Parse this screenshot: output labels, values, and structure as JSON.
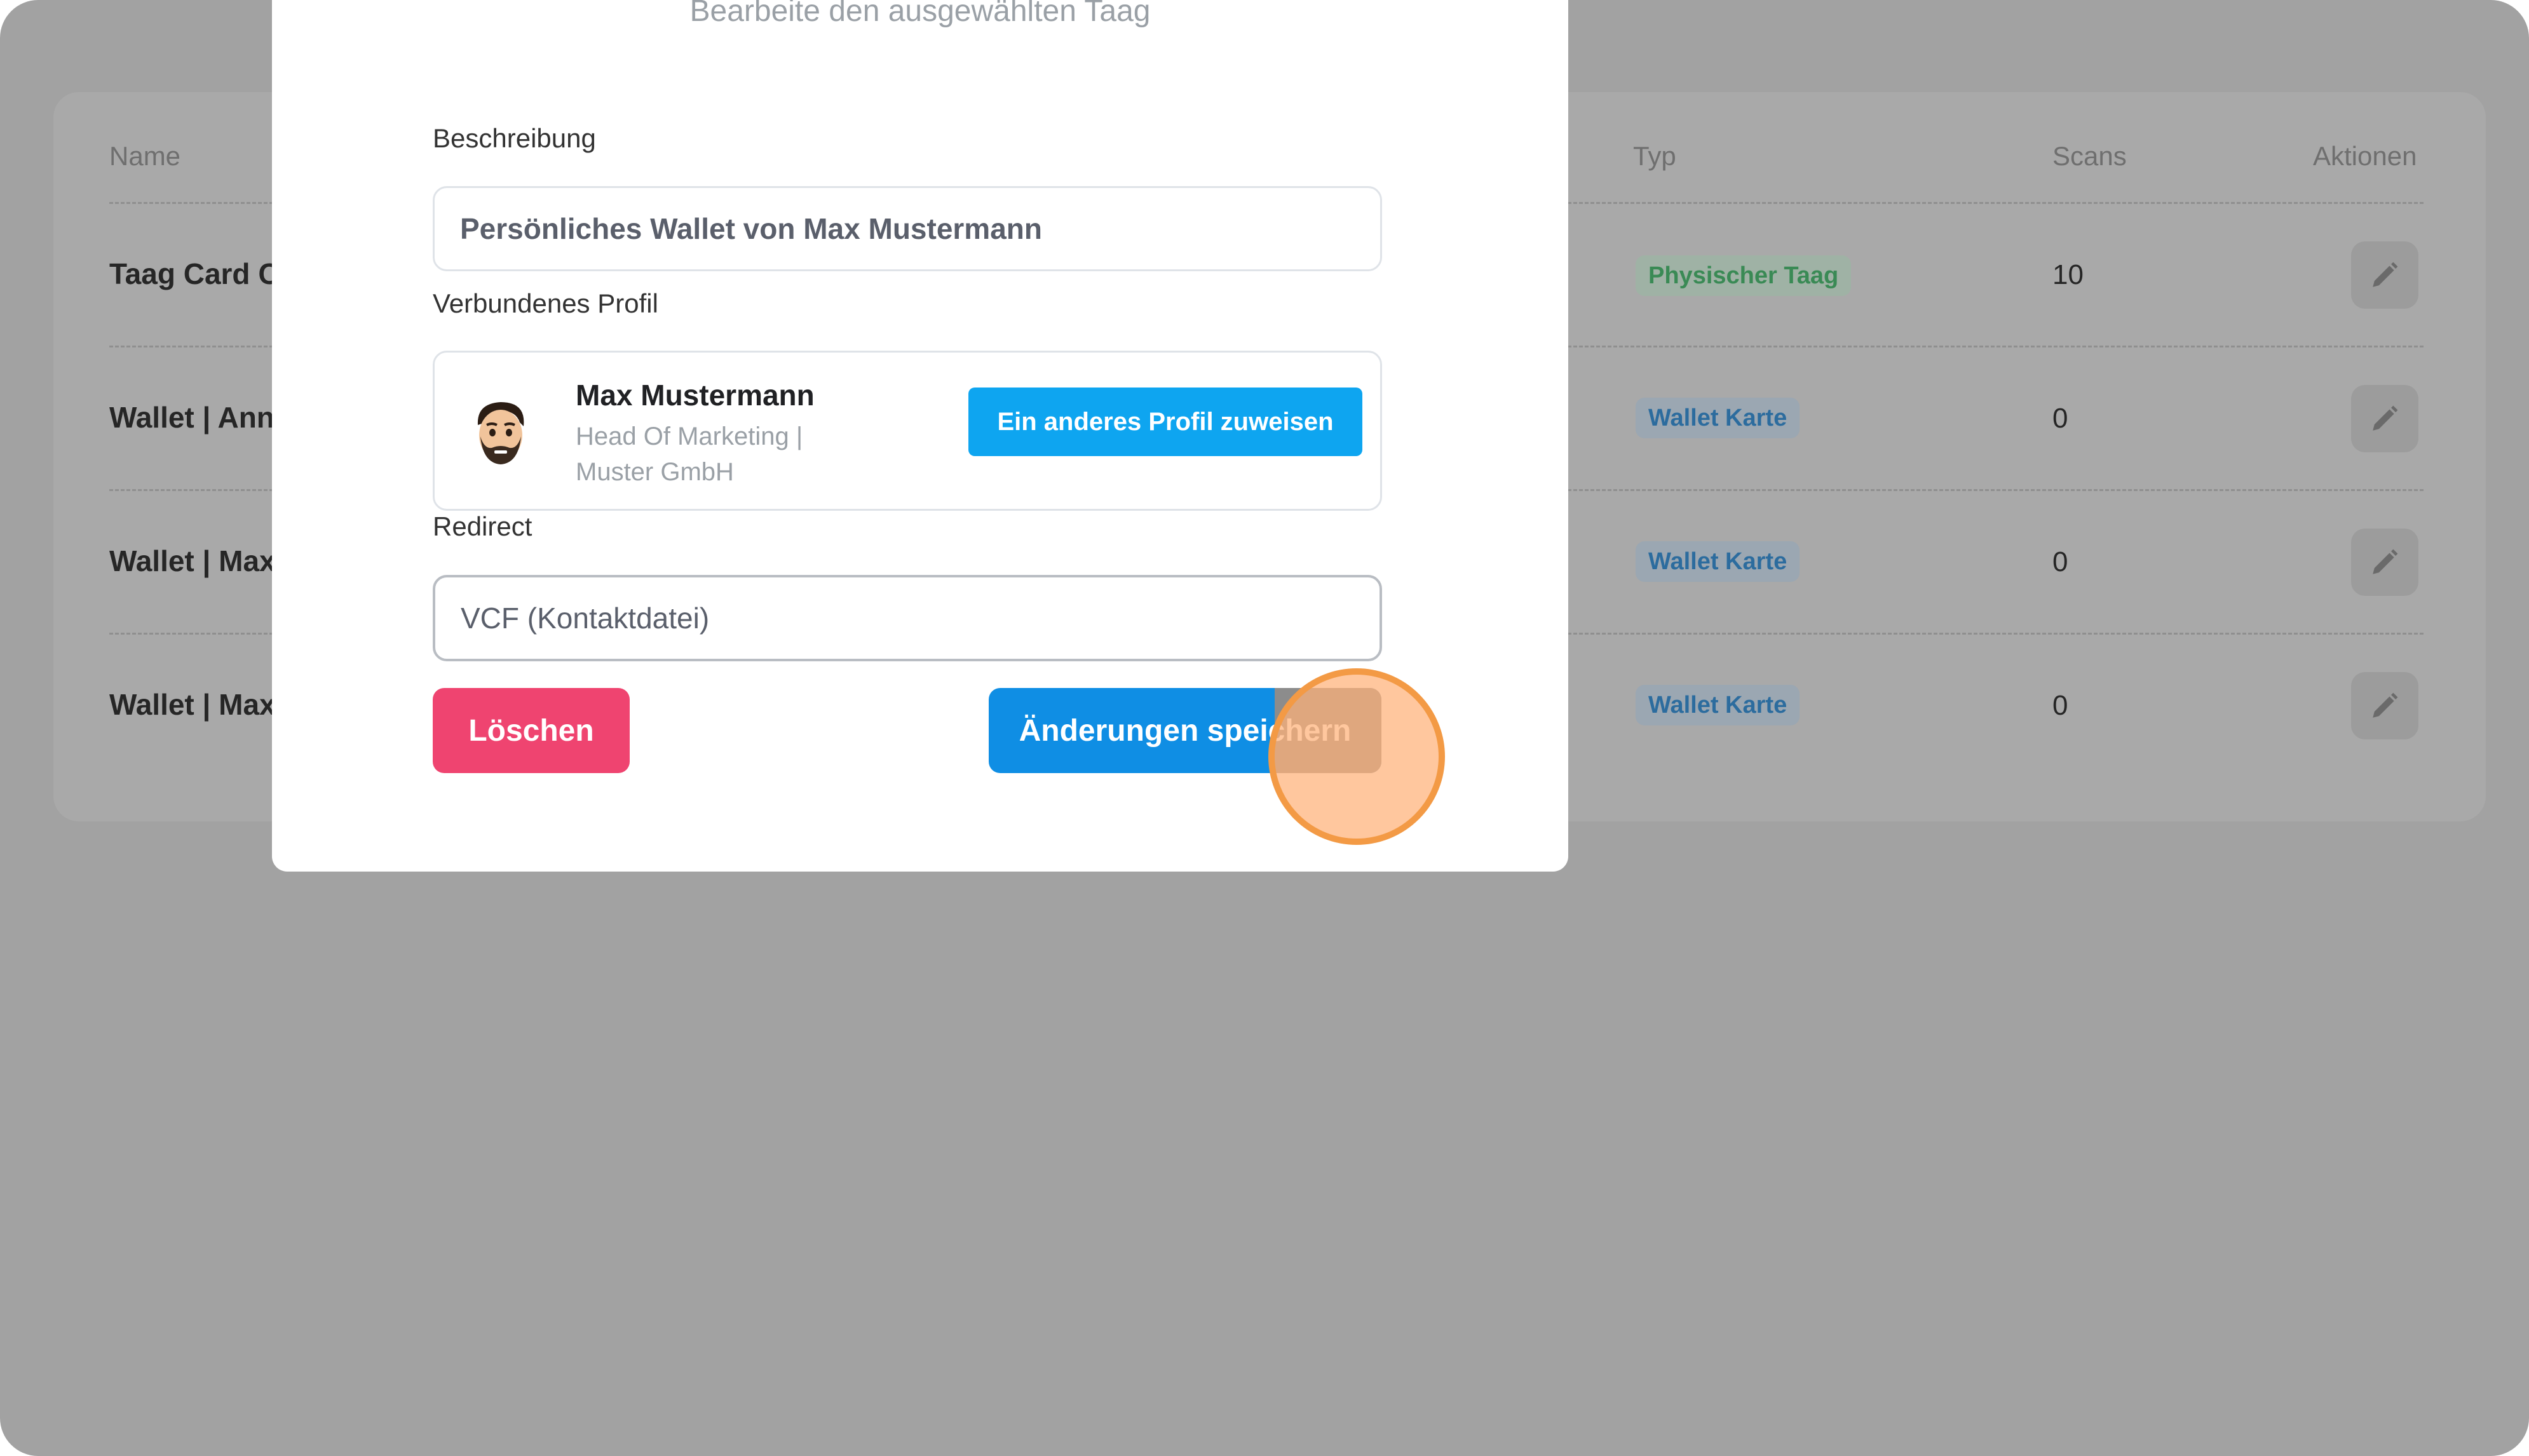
{
  "table": {
    "headers": {
      "name": "Name",
      "type": "Typ",
      "scans": "Scans",
      "actions": "Aktionen"
    },
    "rows": [
      {
        "name": "Taag Card C",
        "type": "Physischer Taag",
        "scans": "10"
      },
      {
        "name": "Wallet | Ann",
        "type": "Wallet Karte",
        "scans": "0"
      },
      {
        "name": "Wallet | Max",
        "type": "Wallet Karte",
        "scans": "0"
      },
      {
        "name": "Wallet | Max",
        "type": "Wallet Karte",
        "scans": "0"
      }
    ]
  },
  "modal": {
    "subtitle": "Bearbeite den ausgewählten Taag",
    "description_label": "Beschreibung",
    "description_value": "Persönliches Wallet von Max Mustermann",
    "profile_label": "Verbundenes Profil",
    "profile": {
      "name": "Max Mustermann",
      "role": "Head Of Marketing | Muster GmbH"
    },
    "assign_button": "Ein anderes Profil zuweisen",
    "redirect_label": "Redirect",
    "redirect_value": "VCF (Kontaktdatei)",
    "delete_button": "Löschen",
    "save_button": "Änderungen speichern"
  },
  "colors": {
    "overlay": "#a2a2a2",
    "primary": "#0f8ee4",
    "assign": "#0ea5f0",
    "danger": "#ef4470",
    "click_indicator": "#f39a45"
  }
}
